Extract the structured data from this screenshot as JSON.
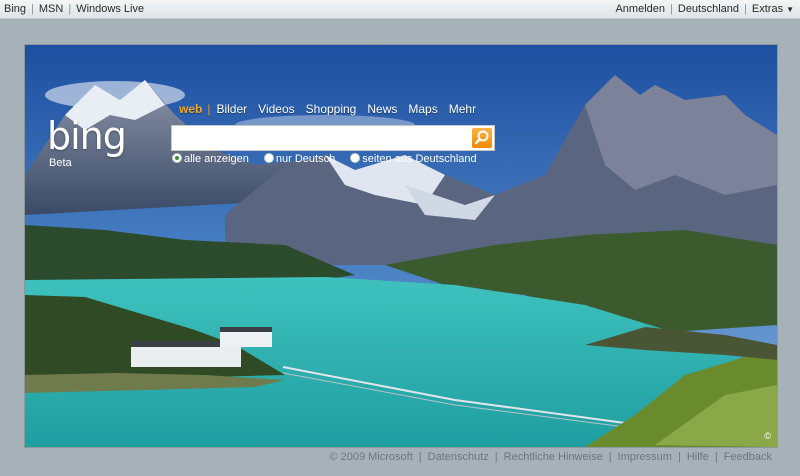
{
  "topbar": {
    "left_links": [
      "Bing",
      "MSN",
      "Windows Live"
    ],
    "right_links": [
      "Anmelden",
      "Deutschland",
      "Extras"
    ]
  },
  "logo": {
    "text": "bing",
    "beta": "Beta"
  },
  "scopes": {
    "items": [
      "web",
      "Bilder",
      "Videos",
      "Shopping",
      "News",
      "Maps",
      "Mehr"
    ],
    "active": "web"
  },
  "search": {
    "value": "",
    "placeholder": ""
  },
  "options": {
    "items": [
      "alle anzeigen",
      "nur Deutsch",
      "seiten aus Deutschland"
    ],
    "selected": "alle anzeigen"
  },
  "footer": {
    "copyright": "© 2009 Microsoft",
    "links": [
      "Datenschutz",
      "Rechtliche Hinweise",
      "Impressum",
      "Hilfe",
      "Feedback"
    ]
  },
  "colors": {
    "accent": "#f5a623",
    "background": "#a7b2b8",
    "lake": "#2fb3b0"
  },
  "icons": {
    "search": "search-icon",
    "copyright_info": "info-icon"
  }
}
